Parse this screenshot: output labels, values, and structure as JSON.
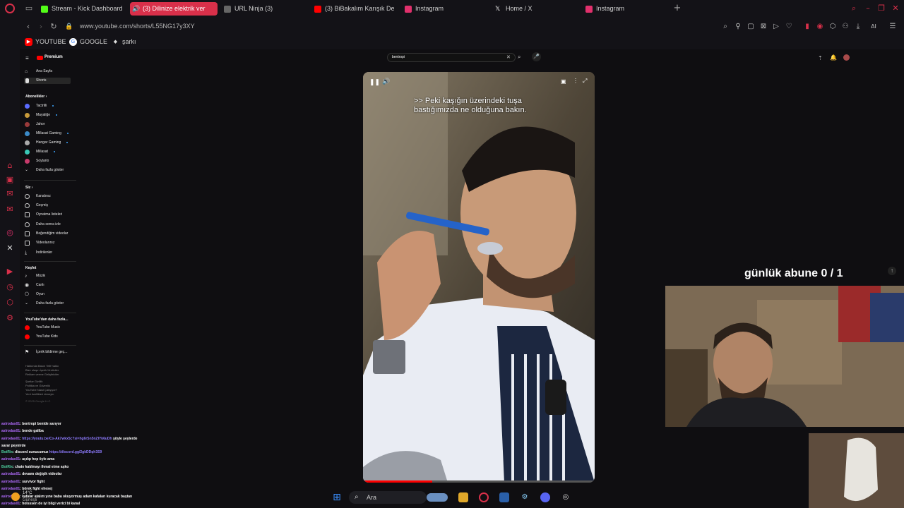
{
  "browser": {
    "tabs": [
      {
        "label": "Stream - Kick Dashboard",
        "color": "#53fc18"
      },
      {
        "label": "(3) Dilinize elektrik ver",
        "color": "#ffffff",
        "active": true
      },
      {
        "label": "URL Ninja (3)",
        "color": "#888888"
      },
      {
        "label": "(3) BiBakalım Karışık Derl",
        "color": "#ff0000"
      },
      {
        "label": "Instagram",
        "color": "#e1306c"
      },
      {
        "label": "Home / X",
        "color": "#ffffff"
      },
      {
        "label": "Instagram",
        "color": "#e1306c"
      }
    ],
    "new_tab": "+",
    "url": "www.youtube.com/shorts/L55NG17y3XY",
    "bookmarks": [
      {
        "label": "YOUTUBE",
        "icon": "youtube-icon"
      },
      {
        "label": "GOOGLE",
        "icon": "google-icon"
      },
      {
        "label": "şarkı",
        "icon": "music-icon"
      }
    ],
    "toolbar_extra": "AI",
    "accent": "#d9304a"
  },
  "youtube": {
    "logo_text": "Premium",
    "search_value": "bentropi",
    "nav": [
      {
        "label": "Ana Sayfa",
        "icon": "home-icon"
      },
      {
        "label": "Shorts",
        "icon": "shorts-icon"
      }
    ],
    "subscriptions_header": "Abonelikler",
    "subscriptions": [
      "Tactrilli",
      "Mayaliğe",
      "Jahor",
      "Millasat Gaming",
      "Hangar Gaming",
      "Millasat",
      "Soytario"
    ],
    "subs_more": "Daha fazla göster",
    "you_header": "Siz",
    "you_items": [
      "Kanalınız",
      "Geçmiş",
      "Oynatma listeleri",
      "Daha sonra izle",
      "Beğendiğim videolar",
      "Videolarınız",
      "İndirilenler"
    ],
    "explore_header": "Keşfet",
    "explore_items": [
      "Müzik",
      "Canlı",
      "Oyun"
    ],
    "explore_more": "Daha fazla göster",
    "more_header": "YouTube'dan daha fazla...",
    "more_items": [
      "YouTube Music",
      "YouTube Kids"
    ],
    "report": "İçerik bildirme geç...",
    "footer_lines": [
      "Hakkında  Basın  Telif hakkı",
      "Bize ulaşın  İçerik Üreticiler",
      "Reklam verme  Geliştiriciler",
      "Şartlar  Gizlilik",
      "Politika ve Güvenlik",
      "YouTube Nasıl Çalışıyor?",
      "Yeni özellikleri deneyin",
      "© 2025 Google LLC"
    ],
    "subtitle": ">> Peki kaşığın üzerindeki tuşa bastığımızda ne olduğuna bakın."
  },
  "stream": {
    "goal": "günlük abune 0 / 1"
  },
  "chat": [
    {
      "user": "aslrodas01",
      "text": ": bentropi benide sarıyor"
    },
    {
      "user": "aslrodas01",
      "text": ": bende galiba"
    },
    {
      "user": "aslrodas01",
      "text": ": ",
      "link": "https://youtu.be/Cx-Ak7wkx5c?si=hg6rSn5nZlYk6uDh",
      "tail": " şöyle şeylerde"
    },
    {
      "user": "",
      "text": "sarar peynirde"
    },
    {
      "user": "BotRix",
      "text": ": discord sunucumuz ",
      "link": "https://discord.gg/2gkDDqh3S9",
      "bot": true
    },
    {
      "user": "aslrodas01",
      "text": ": açılıp hep öyle ama"
    },
    {
      "user": "BotRix",
      "text": ": chate katılmayı ihmal etme aşko",
      "bot": true
    },
    {
      "user": "aslrodas01",
      "text": ": devamı değişik videolar"
    },
    {
      "user": "aslrodas01",
      "text": ": survivor fight"
    },
    {
      "user": "aslrodas01",
      "text": ": börek fight ehesej"
    },
    {
      "user": "aslrodas01",
      "text": ": kafalar atalım yıne baba okuyormuş adam kafaları kuracak baştan"
    },
    {
      "user": "aslrodas01",
      "text": ": hoIsssen de iyi bilgi verici bi kanal"
    }
  ],
  "taskbar": {
    "search_placeholder": "Ara",
    "weather_temp": "14°C",
    "weather_label": "Güneşli"
  }
}
